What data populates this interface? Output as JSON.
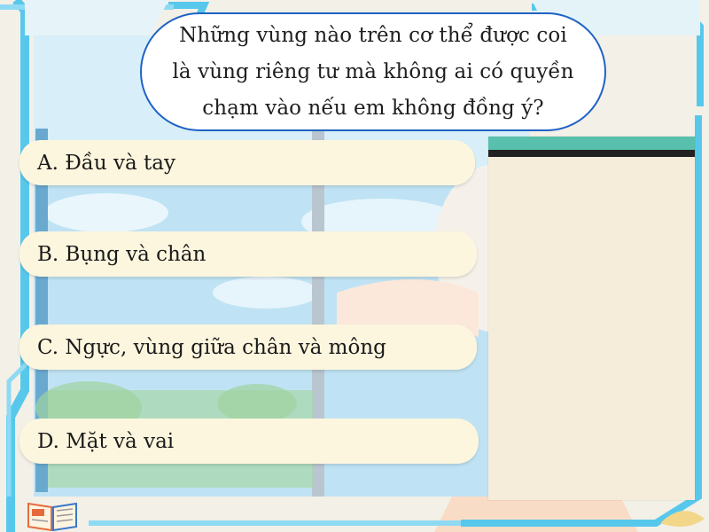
{
  "question": {
    "line1": "Những vùng nào trên cơ thể được coi",
    "line2": "là vùng riêng tư mà không ai có quyền",
    "line3": "chạm vào nếu em không đồng ý?"
  },
  "answers": [
    {
      "label": "A. Đầu và tay"
    },
    {
      "label": "B. Bụng và chân"
    },
    {
      "label": "C. Ngực, vùng giữa chân và mông"
    },
    {
      "label": "D. Mặt và vai"
    }
  ],
  "colors": {
    "frame_blue": "#57c8ec",
    "bubble_border": "#1f63c4",
    "answer_fill": "#fdf6de",
    "panel_fill": "#f5ecda",
    "panel_accent": "#58c0ac"
  },
  "icons": [
    "book-icon"
  ]
}
